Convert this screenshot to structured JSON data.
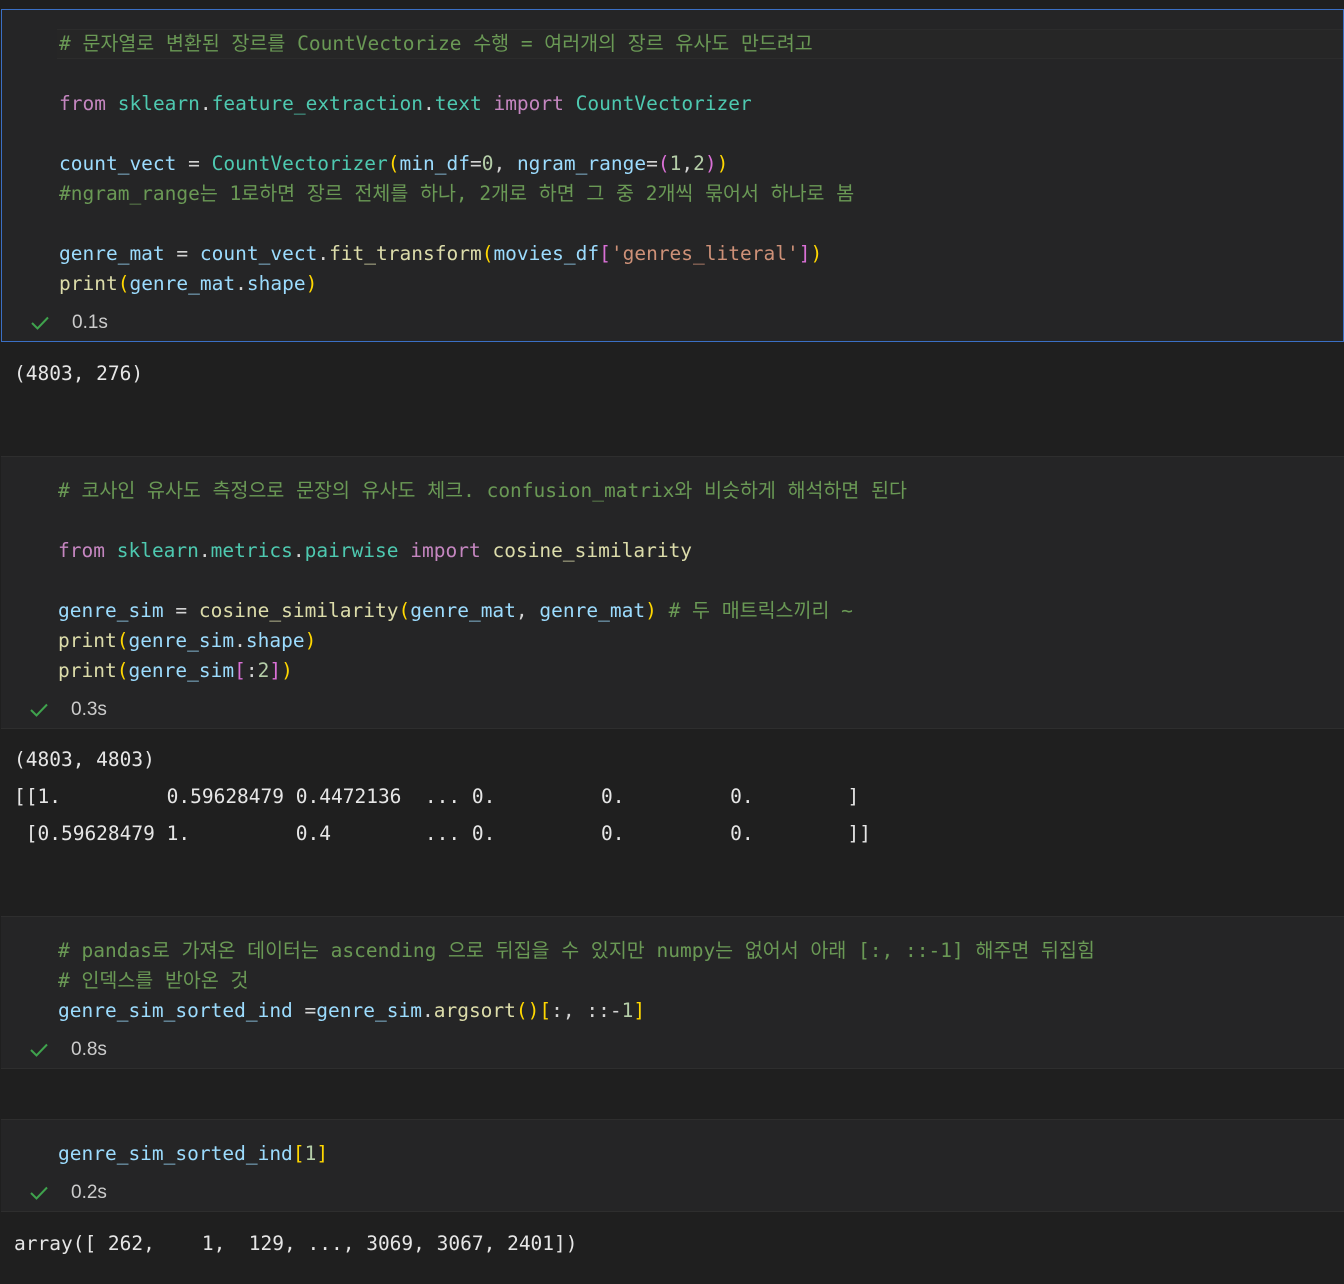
{
  "cells": [
    {
      "lines": [
        "# 문자열로 변환된 장르를 CountVectorize 수행 = 여러개의 장르 유사도 만드려고",
        "",
        "from sklearn.feature_extraction.text import CountVectorizer",
        "",
        "count_vect = CountVectorizer(min_df=0, ngram_range=(1,2))",
        "#ngram_range는 1로하면 장르 전체를 하나, 2개로 하면 그 중 2개씩 묶어서 하나로 봄",
        "",
        "genre_mat = count_vect.fit_transform(movies_df['genres_literal'])",
        "print(genre_mat.shape)"
      ],
      "exec_time": "0.1s",
      "output": [
        "(4803, 276)"
      ]
    },
    {
      "lines": [
        "# 코사인 유사도 측정으로 문장의 유사도 체크. confusion_matrix와 비슷하게 해석하면 된다",
        "",
        "from sklearn.metrics.pairwise import cosine_similarity",
        "",
        "genre_sim = cosine_similarity(genre_mat, genre_mat) # 두 매트릭스끼리 ~",
        "print(genre_sim.shape)",
        "print(genre_sim[:2])"
      ],
      "exec_time": "0.3s",
      "output": [
        "(4803, 4803)",
        "[[1.         0.59628479 0.4472136  ... 0.         0.         0.        ]",
        " [0.59628479 1.         0.4        ... 0.         0.         0.        ]]"
      ]
    },
    {
      "lines": [
        "# pandas로 가져온 데이터는 ascending 으로 뒤집을 수 있지만 numpy는 없어서 아래 [:, ::-1] 해주면 뒤집힘",
        "# 인덱스를 받아온 것",
        "genre_sim_sorted_ind =genre_sim.argsort()[:, ::-1]"
      ],
      "exec_time": "0.8s",
      "output": []
    },
    {
      "lines": [
        "genre_sim_sorted_ind[1]"
      ],
      "exec_time": "0.2s",
      "output": [
        "array([ 262,    1,  129, ..., 3069, 3067, 2401])"
      ]
    }
  ]
}
